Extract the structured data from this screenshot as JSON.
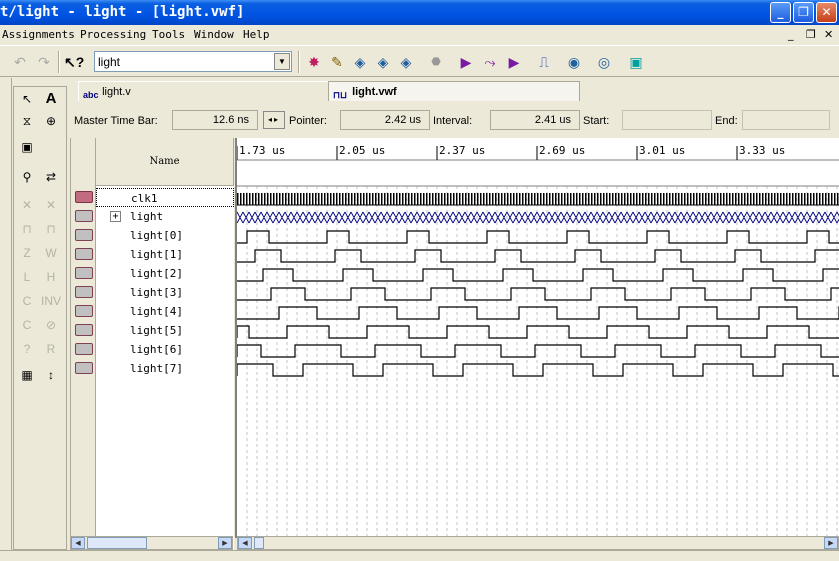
{
  "window": {
    "title": "t/light - light - [light.vwf]",
    "buttons": {
      "minimize": "_",
      "restore": "❐",
      "close": "✕"
    }
  },
  "menu": {
    "items": [
      "Assignments",
      "Processing",
      "Tools",
      "Window",
      "Help"
    ],
    "mdi": {
      "minimize": "_",
      "restore": "❐",
      "close": "✕"
    }
  },
  "toolbar": {
    "combo_value": "light"
  },
  "tabs": [
    {
      "label": "light.v",
      "icon": "abc"
    },
    {
      "label": "light.vwf",
      "icon": "wave"
    }
  ],
  "timebar": {
    "master_label": "Master Time Bar:",
    "master_value": "12.6 ns",
    "pointer_label": "Pointer:",
    "pointer_value": "2.42 us",
    "interval_label": "Interval:",
    "interval_value": "2.41 us",
    "start_label": "Start:",
    "start_value": "",
    "end_label": "End:",
    "end_value": ""
  },
  "name_header": "Name",
  "signals": [
    {
      "name": "clk1",
      "type": "input"
    },
    {
      "name": "light",
      "type": "bus",
      "expander": "+"
    },
    {
      "name": "light[0]",
      "type": "output"
    },
    {
      "name": "light[1]",
      "type": "output"
    },
    {
      "name": "light[2]",
      "type": "output"
    },
    {
      "name": "light[3]",
      "type": "output"
    },
    {
      "name": "light[4]",
      "type": "output"
    },
    {
      "name": "light[5]",
      "type": "output"
    },
    {
      "name": "light[6]",
      "type": "output"
    },
    {
      "name": "light[7]",
      "type": "output"
    }
  ],
  "time_ticks": [
    "1.73 us",
    "2.05 us",
    "2.37 us",
    "2.69 us",
    "3.01 us",
    "3.33 us"
  ],
  "colors": {
    "titlebar": "#0054e3",
    "wave": "#000000",
    "bus_wave": "#000080",
    "gridline": "#a0a0a0"
  }
}
